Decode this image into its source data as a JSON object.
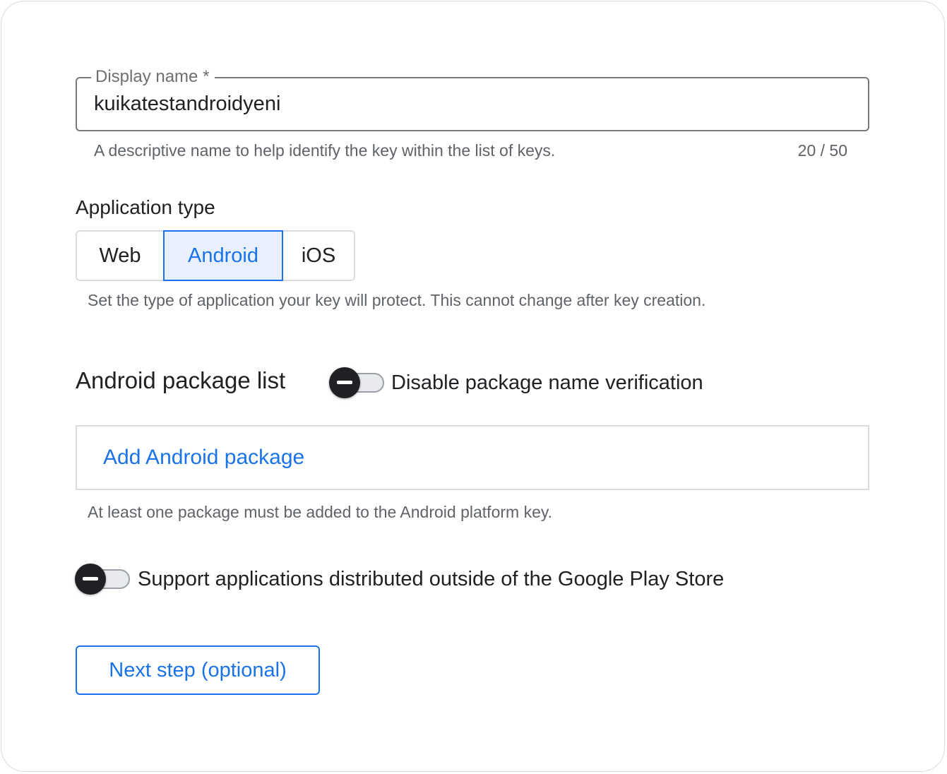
{
  "display_name": {
    "label": "Display name *",
    "value": "kuikatestandroidyeni",
    "hint": "A descriptive name to help identify the key within the list of keys.",
    "counter": "20 / 50"
  },
  "application_type": {
    "title": "Application type",
    "options": [
      "Web",
      "Android",
      "iOS"
    ],
    "selected": "Android",
    "hint": "Set the type of application your key will protect. This cannot change after key creation."
  },
  "android_packages": {
    "title": "Android package list",
    "disable_verification_label": "Disable package name verification",
    "disable_verification_on": false,
    "add_label": "Add Android package",
    "hint": "At least one package must be added to the Android platform key."
  },
  "outside_play_store": {
    "label": "Support applications distributed outside of the Google Play Store",
    "on": false
  },
  "next_button": {
    "label": "Next step (optional)"
  },
  "colors": {
    "accent": "#1a73e8",
    "selected_bg": "#e8f0fe"
  }
}
